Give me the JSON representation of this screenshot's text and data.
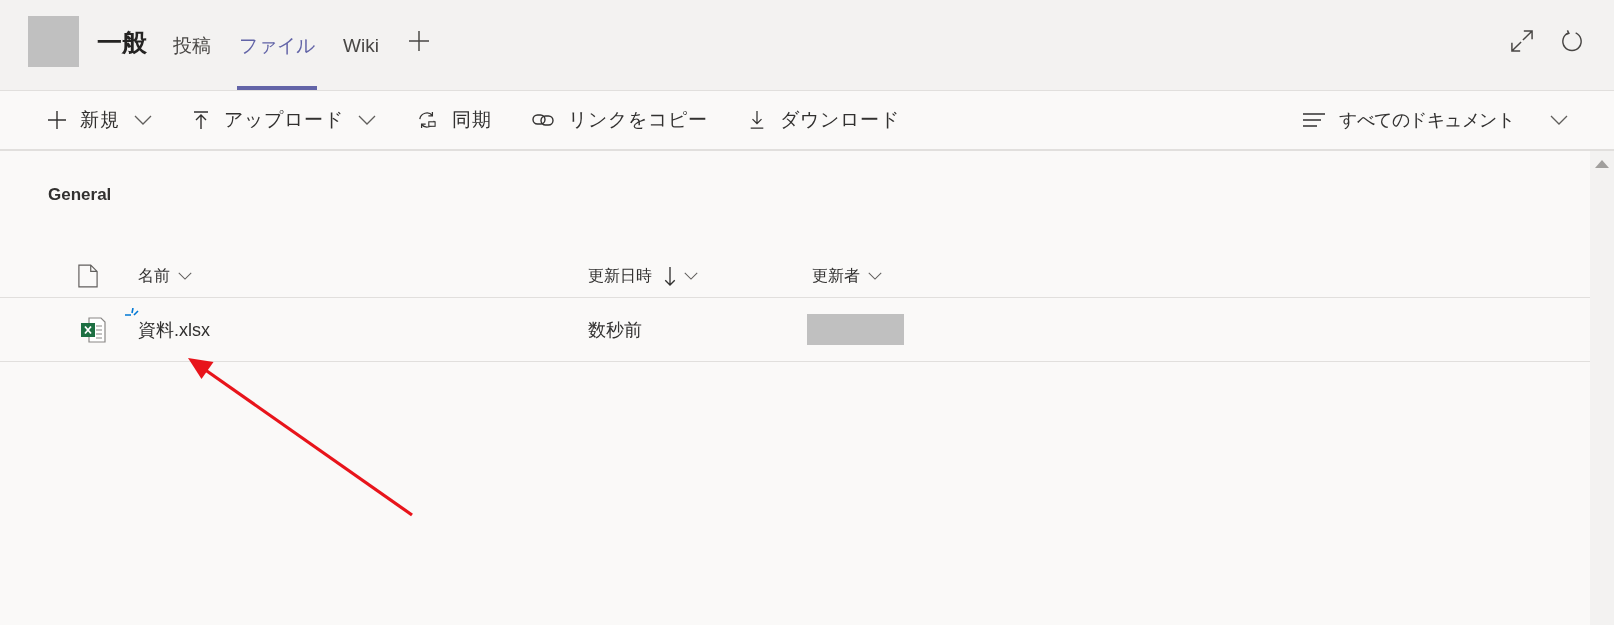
{
  "header": {
    "channel_name": "一般",
    "tabs": [
      {
        "label": "投稿",
        "selected": false
      },
      {
        "label": "ファイル",
        "selected": true
      },
      {
        "label": "Wiki",
        "selected": false
      }
    ]
  },
  "toolbar": {
    "actions": [
      {
        "kind": "new",
        "label": "新規",
        "dropdown": true
      },
      {
        "kind": "upload",
        "label": "アップロード",
        "dropdown": true
      },
      {
        "kind": "sync",
        "label": "同期",
        "dropdown": false
      },
      {
        "kind": "copy_link",
        "label": "リンクをコピー",
        "dropdown": false
      },
      {
        "kind": "download",
        "label": "ダウンロード",
        "dropdown": false
      }
    ],
    "view": {
      "label": "すべてのドキュメント"
    }
  },
  "library": {
    "title": "General",
    "columns": [
      {
        "label": "名前",
        "sorted": false
      },
      {
        "label": "更新日時",
        "sorted": true
      },
      {
        "label": "更新者",
        "sorted": false
      }
    ],
    "rows": [
      {
        "name": "資料.xlsx",
        "modified": "数秒前",
        "new": true
      }
    ]
  }
}
